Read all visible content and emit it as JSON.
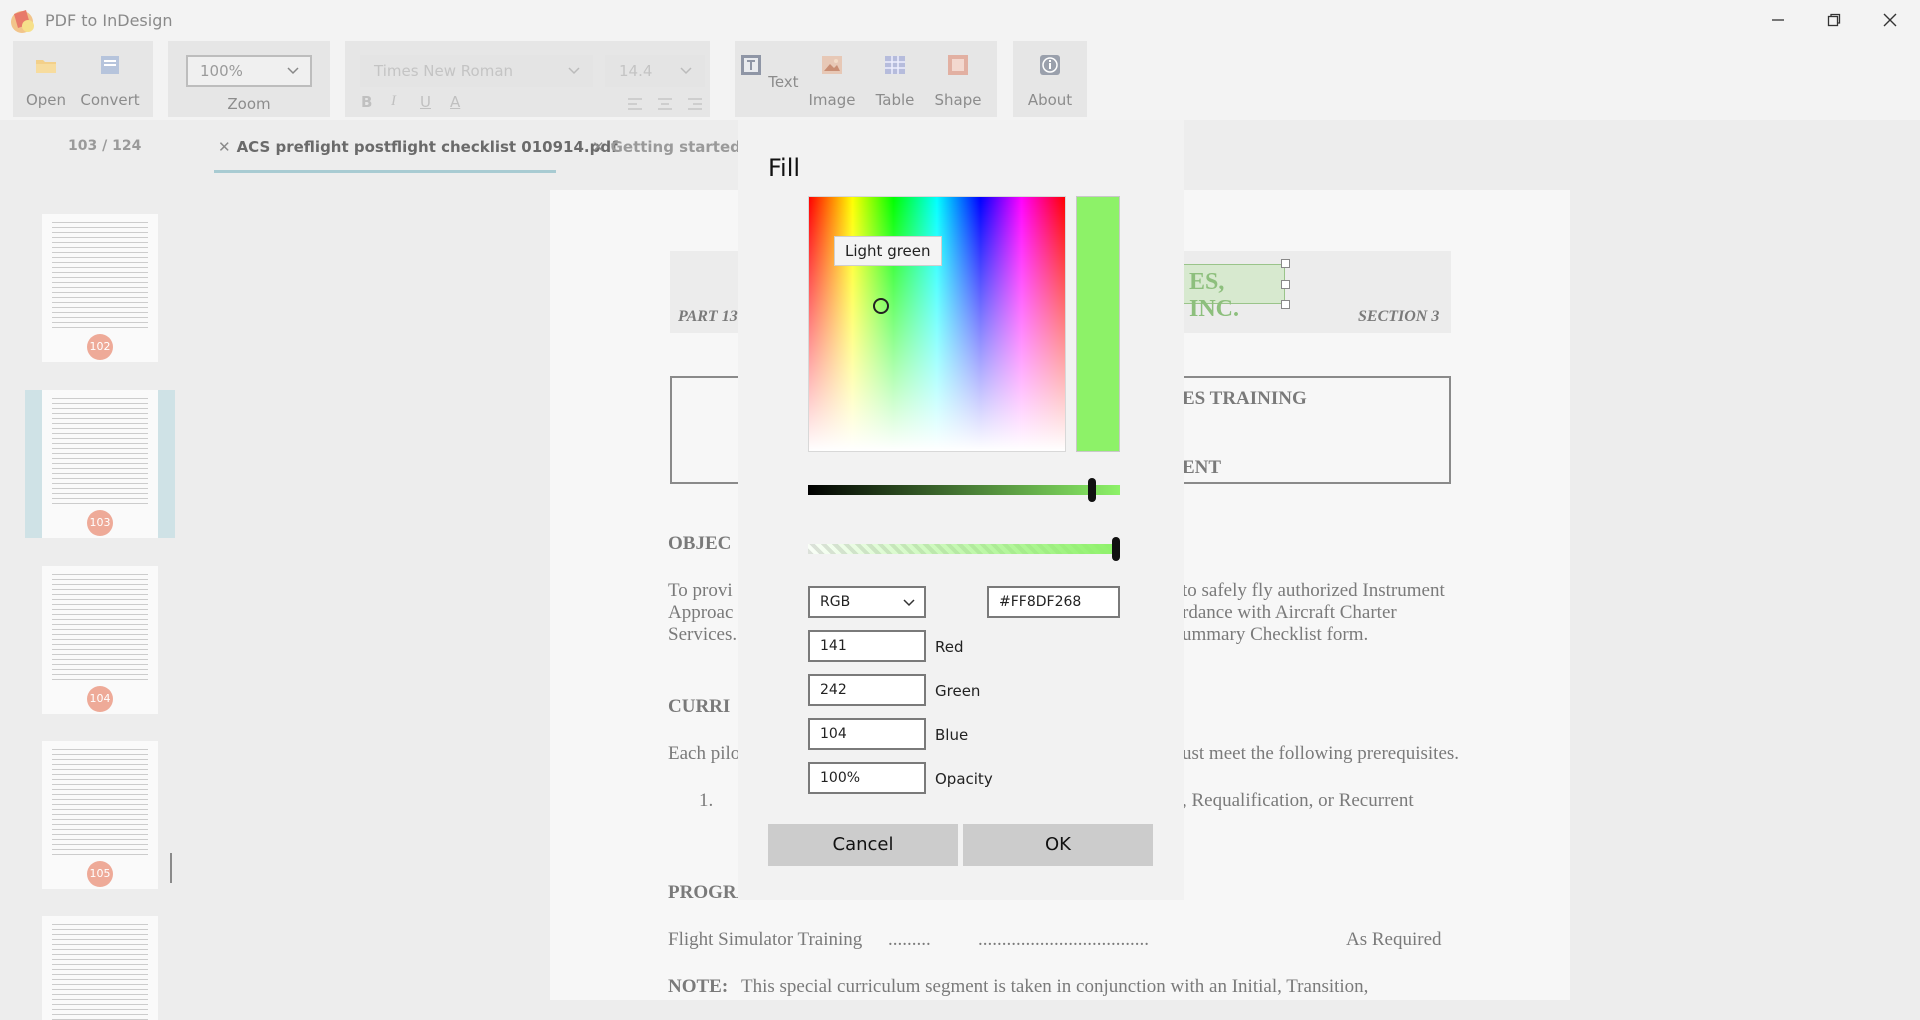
{
  "app": {
    "title": "PDF to InDesign",
    "window_controls": {
      "minimize": "minimize-icon",
      "restore": "restore-icon",
      "close": "close-icon"
    }
  },
  "ribbon": {
    "open_label": "Open",
    "convert_label": "Convert",
    "zoom_value": "100%",
    "zoom_label": "Zoom",
    "font_name": "Times New Roman",
    "font_size": "14.4",
    "text_label": "Text",
    "image_label": "Image",
    "table_label": "Table",
    "shape_label": "Shape",
    "about_label": "About",
    "format_icons": [
      "bold-icon",
      "italic-icon",
      "underline-icon",
      "font-color-icon",
      "align-left-icon",
      "align-center-icon",
      "align-right-icon"
    ]
  },
  "tabs": {
    "page_indicator": "103 / 124",
    "items": [
      {
        "label": "ACS preflight postflight checklist 010914.pdf",
        "active": true
      },
      {
        "label": "Getting started wi",
        "active": false
      }
    ]
  },
  "thumbnails": [
    {
      "page": "102",
      "selected": false
    },
    {
      "page": "103",
      "selected": true
    },
    {
      "page": "104",
      "selected": false
    },
    {
      "page": "105",
      "selected": false
    },
    {
      "page": "",
      "selected": false
    }
  ],
  "document": {
    "header_title_fragment": "ES, INC.",
    "part_label": "PART 13",
    "section_label": "SECTION 3",
    "box_line1": "ES TRAINING",
    "box_line2": "ENT",
    "objective_heading": "OBJEC",
    "para1": [
      {
        "left": "To provi",
        "right": "to safely fly authorized Instrument"
      },
      {
        "left": "Approac",
        "right": "rdance with Aircraft Charter"
      },
      {
        "left": "Services.",
        "right": "ummary Checklist form."
      }
    ],
    "curriculum_heading": "CURRI",
    "para2_left": "Each pilo",
    "para2_right": "ust meet the following prerequisites.",
    "item_number": "1.",
    "item_right": ", Requalification, or Recurrent",
    "programmed_heading": "PROGRAMMED TRAINING HOURS",
    "sim_label": "Flight Simulator Training",
    "sim_dots1": ".........",
    "sim_dots2": "....................................",
    "sim_value": "As Required",
    "note_label": "NOTE:",
    "note_text": "This special curriculum segment is taken in conjunction with an Initial, Transition,"
  },
  "dialog": {
    "title": "Fill",
    "tooltip": "Light green",
    "fill_color": "#8DF268",
    "color_mode": "RGB",
    "hex_value": "#FF8DF268",
    "red": {
      "value": "141",
      "label": "Red"
    },
    "green": {
      "value": "242",
      "label": "Green"
    },
    "blue": {
      "value": "104",
      "label": "Blue"
    },
    "opacity": {
      "value": "100%",
      "label": "Opacity"
    },
    "value_level": 0.92,
    "opacity_level": 1.0,
    "cancel_label": "Cancel",
    "ok_label": "OK"
  }
}
